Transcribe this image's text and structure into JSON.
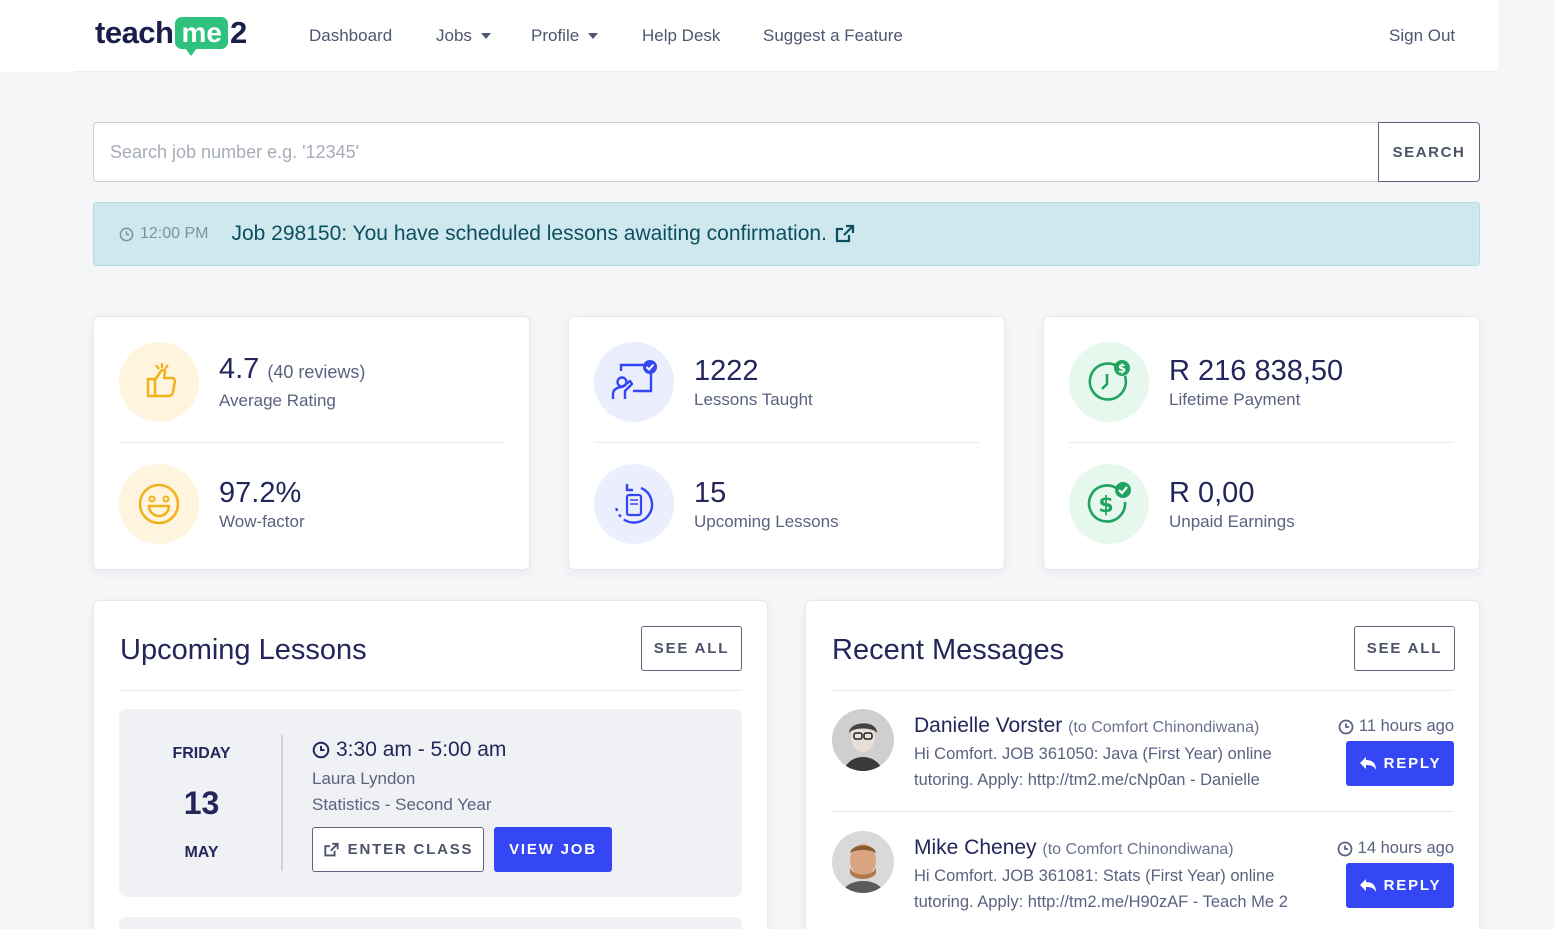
{
  "brand": {
    "part1": "teach",
    "part2": "me",
    "part3": "2"
  },
  "nav": {
    "dashboard": "Dashboard",
    "jobs": "Jobs",
    "profile": "Profile",
    "help": "Help Desk",
    "suggest": "Suggest a Feature",
    "signout": "Sign Out"
  },
  "search": {
    "placeholder": "Search job number e.g. '12345'",
    "button": "SEARCH"
  },
  "alert": {
    "time": "12:00 PM",
    "message": "Job 298150: You have scheduled lessons awaiting confirmation."
  },
  "stats": {
    "rating": {
      "value": "4.7",
      "reviews": "(40 reviews)",
      "label": "Average Rating",
      "icon": "thumbs-up-icon"
    },
    "wow": {
      "value": "97.2%",
      "label": "Wow-factor",
      "icon": "smiley-icon"
    },
    "taught": {
      "value": "1222",
      "label": "Lessons Taught",
      "icon": "teacher-board-icon"
    },
    "upcoming": {
      "value": "15",
      "label": "Upcoming Lessons",
      "icon": "tablet-refresh-icon"
    },
    "lifetime": {
      "value": "R 216 838,50",
      "label": "Lifetime Payment",
      "icon": "clock-dollar-icon"
    },
    "unpaid": {
      "value": "R 0,00",
      "label": "Unpaid Earnings",
      "icon": "dollar-check-icon"
    }
  },
  "upcoming_lessons": {
    "title": "Upcoming Lessons",
    "see_all": "SEE ALL",
    "lesson": {
      "weekday": "FRIDAY",
      "day": "13",
      "month": "MAY",
      "time": "3:30 am - 5:00 am",
      "student": "Laura Lyndon",
      "subject": "Statistics - Second Year",
      "enter_class": "ENTER CLASS",
      "view_job": "VIEW JOB"
    }
  },
  "recent_messages": {
    "title": "Recent Messages",
    "see_all": "SEE ALL",
    "reply": "REPLY",
    "items": [
      {
        "name": "Danielle Vorster",
        "to": "(to Comfort Chinondiwana)",
        "time": "11 hours ago",
        "body": "Hi Comfort. JOB 361050: Java (First Year) online tutoring. Apply: http://tm2.me/cNp0an - Danielle"
      },
      {
        "name": "Mike Cheney",
        "to": "(to Comfort Chinondiwana)",
        "time": "14 hours ago",
        "body": "Hi Comfort. JOB 361081: Stats (First Year) online tutoring. Apply: http://tm2.me/H90zAF - Teach Me 2"
      }
    ]
  },
  "colors": {
    "accent": "#3547f5",
    "brand_green": "#2ec27e",
    "alert_bg": "#cfe8ee"
  }
}
